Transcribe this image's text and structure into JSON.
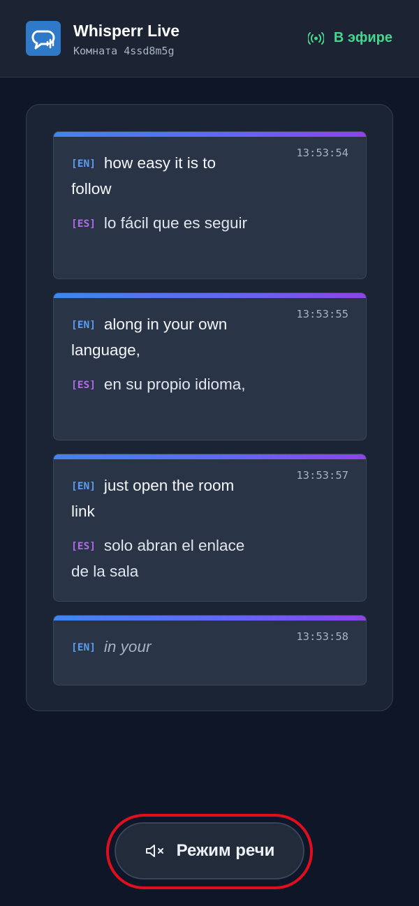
{
  "app": {
    "title": "Whisperr Live",
    "room_label": "Комната 4ssd8m5g",
    "status": "В эфире",
    "logo_icon": "chat-audio-logo-icon",
    "live_icon": "broadcast-icon",
    "colors": {
      "logo": "#2f7ac8",
      "live": "#45d88d",
      "english_tag": "#5c9cf0",
      "spanish_tag": "#b36ae6",
      "highlight": "#e00f1e"
    }
  },
  "transcript": [
    {
      "time": "13:53:54",
      "en_tag": "[EN]",
      "en_text": "how easy it is to follow",
      "es_tag": "[ES]",
      "es_text": "lo fácil que es seguir"
    },
    {
      "time": "13:53:55",
      "en_tag": "[EN]",
      "en_text": "along in your own language,",
      "es_tag": "[ES]",
      "es_text": "en su propio idioma,"
    },
    {
      "time": "13:53:57",
      "en_tag": "[EN]",
      "en_text": "just open the room link",
      "es_tag": "[ES]",
      "es_text": "solo abran el enlace de la sala"
    },
    {
      "time": "13:53:58",
      "en_tag": "[EN]",
      "en_text": "in your",
      "pending": true
    }
  ],
  "controls": {
    "speech_mode_label": "Режим речи",
    "speech_mode_icon": "speaker-muted-icon"
  }
}
